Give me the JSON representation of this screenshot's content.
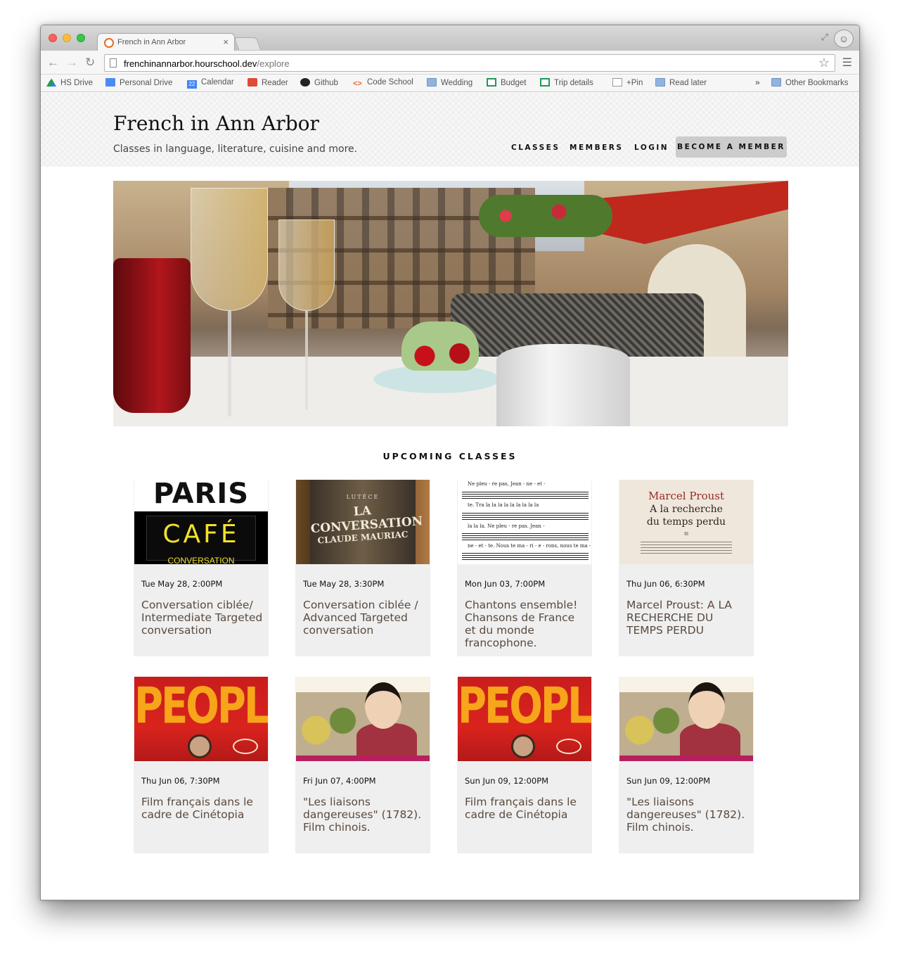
{
  "browser": {
    "tab_title": "French in Ann Arbor",
    "tab_close": "×",
    "url_host": "frenchinannarbor.hourschool.dev",
    "url_path": "/explore",
    "bookmarks": [
      {
        "label": "HS Drive",
        "icon": "drive-icon"
      },
      {
        "label": "Personal Drive",
        "icon": "doc-icon"
      },
      {
        "label": "Calendar",
        "icon": "calendar-icon",
        "badge": "22"
      },
      {
        "label": "Reader",
        "icon": "reader-icon"
      },
      {
        "label": "Github",
        "icon": "github-icon"
      },
      {
        "label": "Code School",
        "icon": "code-icon",
        "glyph": "<>"
      },
      {
        "label": "Wedding",
        "icon": "folder-icon"
      },
      {
        "label": "Budget",
        "icon": "spreadsheet-icon"
      },
      {
        "label": "Trip details",
        "icon": "spreadsheet-icon"
      },
      {
        "label": "+Pin",
        "icon": "page-icon"
      },
      {
        "label": "Read later",
        "icon": "folder-icon"
      }
    ],
    "bookmarks_overflow": "»",
    "other_bookmarks": "Other Bookmarks"
  },
  "site": {
    "title": "French in Ann Arbor",
    "tagline": "Classes in language, literature, cuisine and more.",
    "nav": {
      "classes": "CLASSES",
      "members": "MEMBERS",
      "login": "LOGIN",
      "become_member": "BECOME A MEMBER"
    }
  },
  "section": {
    "heading": "UPCOMING CLASSES"
  },
  "cards": [
    {
      "date": "Tue May 28, 2:00PM",
      "title": "Conversation ciblée/ Intermediate Targeted conversation",
      "image": "paris-cafe-poster",
      "img_text": [
        "PARIS",
        "CAFÉ",
        "CONVERSATION"
      ]
    },
    {
      "date": "Tue May 28, 3:30PM",
      "title": "Conversation ciblée / Advanced Targeted conversation",
      "image": "book-spine",
      "img_text": [
        "LUTÈCE",
        "LA CONVERSATION",
        "CLAUDE MAURIAC"
      ]
    },
    {
      "date": "Mon Jun 03, 7:00PM",
      "title": "Chantons ensemble! Chansons de France et du monde francophone.",
      "image": "sheet-music",
      "img_text": [
        "Ne pleu - re pas, Jean - ne - et -",
        "te. Tra la la la la la la la la la",
        "la la la. Ne pleu - re pas. Jean -",
        "ne - et - te. Nous te ma - ri - e - rons, nous te ma -"
      ]
    },
    {
      "date": "Thu Jun 06, 6:30PM",
      "title": "Marcel Proust: A LA RECHERCHE DU TEMPS PERDU",
      "image": "proust-title-page",
      "img_text": [
        "Marcel Proust",
        "A la recherche",
        "du temps perdu",
        "III"
      ]
    },
    {
      "date": "Thu Jun 06, 7:30PM",
      "title": "Film français dans le cadre de Cinétopia",
      "image": "film-poster-people",
      "img_text": [
        "PEOPLE"
      ]
    },
    {
      "date": "Fri Jun 07, 4:00PM",
      "title": "\"Les liaisons dangereuses\" (1782). Film chinois.",
      "image": "film-still-woman",
      "img_text": []
    },
    {
      "date": "Sun Jun 09, 12:00PM",
      "title": "Film français dans le cadre de Cinétopia",
      "image": "film-poster-people",
      "img_text": [
        "PEOPLE"
      ]
    },
    {
      "date": "Sun Jun 09, 12:00PM",
      "title": "\"Les liaisons dangereuses\" (1782). Film chinois.",
      "image": "film-still-woman",
      "img_text": []
    }
  ]
}
